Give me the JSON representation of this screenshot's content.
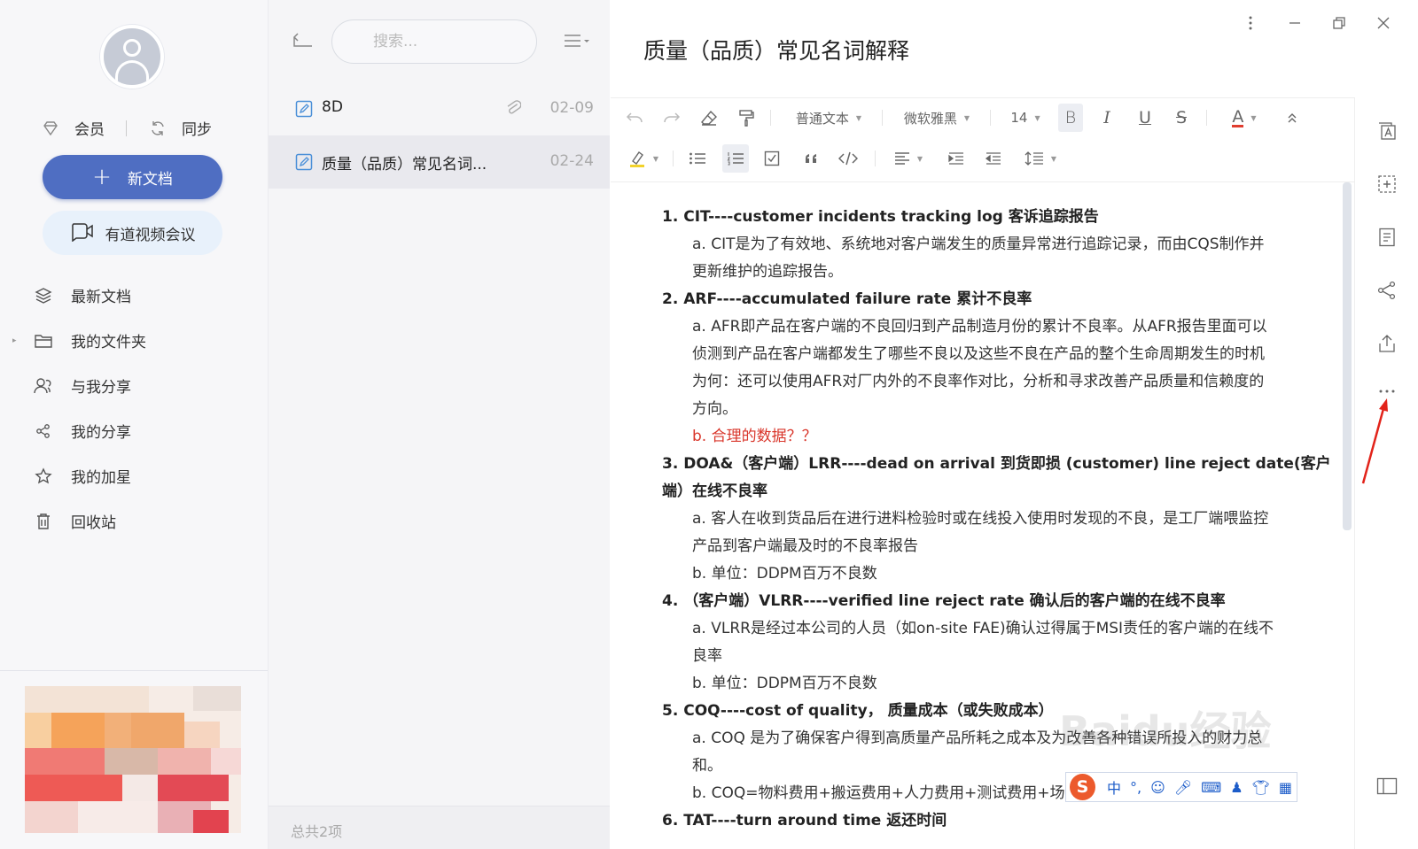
{
  "sidebar": {
    "member_label": "会员",
    "sync_label": "同步",
    "new_doc_label": "新文档",
    "video_meeting_label": "有道视频会议",
    "nav": [
      {
        "label": "最新文档",
        "icon": "layers-icon"
      },
      {
        "label": "我的文件夹",
        "icon": "folder-icon"
      },
      {
        "label": "与我分享",
        "icon": "shared-with-me-icon"
      },
      {
        "label": "我的分享",
        "icon": "share-icon"
      },
      {
        "label": "我的加星",
        "icon": "star-icon"
      },
      {
        "label": "回收站",
        "icon": "trash-icon"
      }
    ]
  },
  "list": {
    "search_placeholder": "搜索...",
    "files": [
      {
        "name": "8D",
        "date": "02-09",
        "has_attachment": true
      },
      {
        "name": "质量（品质）常见名词...",
        "date": "02-24",
        "has_attachment": false
      }
    ],
    "footer": "总共2项"
  },
  "editor": {
    "title": "质量（品质）常见名词解释",
    "toolbar": {
      "text_style": "普通文本",
      "font": "微软雅黑",
      "font_size": "14",
      "bold": "B",
      "italic": "I",
      "underline": "U",
      "strike": "S",
      "font_color": "A"
    },
    "lines": [
      {
        "num": "1.",
        "text": "CIT----customer incidents tracking log 客诉追踪报告",
        "kind": "h"
      },
      {
        "text": "a. CIT是为了有效地、系统地对客户端发生的质量异常进行追踪记录，而由CQS制作并",
        "kind": "p"
      },
      {
        "text": "更新维护的追踪报告。",
        "kind": "p"
      },
      {
        "num": "2.",
        "text": "ARF----accumulated failure rate 累计不良率",
        "kind": "h"
      },
      {
        "text": "a. AFR即产品在客户端的不良回归到产品制造月份的累计不良率。从AFR报告里面可以",
        "kind": "p"
      },
      {
        "text": "侦测到产品在客户端都发生了哪些不良以及这些不良在产品的整个生命周期发生的时机",
        "kind": "p"
      },
      {
        "text": "为何：还可以使用AFR对厂内外的不良率作对比，分析和寻求改善产品质量和信赖度的",
        "kind": "p"
      },
      {
        "text": "方向。",
        "kind": "p"
      },
      {
        "text": "b. 合理的数据？？",
        "kind": "red"
      },
      {
        "num": "3.",
        "text": "DOA&（客户端）LRR----dead on arrival 到货即损 (customer) line reject date(客户",
        "kind": "h"
      },
      {
        "text": "端）在线不良率",
        "kind": "hc"
      },
      {
        "text": "a. 客人在收到货品后在进行进料检验时或在线投入使用时发现的不良，是工厂端喂监控",
        "kind": "p"
      },
      {
        "text": "产品到客户端最及时的不良率报告",
        "kind": "p"
      },
      {
        "text": "b. 单位：DDPM百万不良数",
        "kind": "p"
      },
      {
        "num": "4.",
        "text": "（客户端）VLRR----verified line reject rate 确认后的客户端的在线不良率",
        "kind": "h"
      },
      {
        "text": "a. VLRR是经过本公司的人员（如on-site FAE)确认过得属于MSI责任的客户端的在线不",
        "kind": "p"
      },
      {
        "text": "良率",
        "kind": "p"
      },
      {
        "text": "b. 单位：DDPM百万不良数",
        "kind": "p"
      },
      {
        "num": "5.",
        "text": "COQ----cost of quality， 质量成本（或失败成本）",
        "kind": "h"
      },
      {
        "text": "a. COQ 是为了确保客户得到高质量产品所耗之成本及为改善各种错误所投入的财力总",
        "kind": "p"
      },
      {
        "text": "和。",
        "kind": "p"
      },
      {
        "text": "b. COQ=物料费用+搬运费用+人力费用+测试费用+场地费用+国家赋税",
        "kind": "p"
      },
      {
        "num": "6.",
        "text": "TAT----turn around time 返还时间",
        "kind": "h"
      }
    ]
  },
  "watermark": "Baidu经验",
  "ime": {
    "logo": "S",
    "mode": "中"
  },
  "colors": {
    "accent": "#4f6ec2",
    "red_text": "#d9362b",
    "meeting_bg": "#e8f1fb"
  }
}
